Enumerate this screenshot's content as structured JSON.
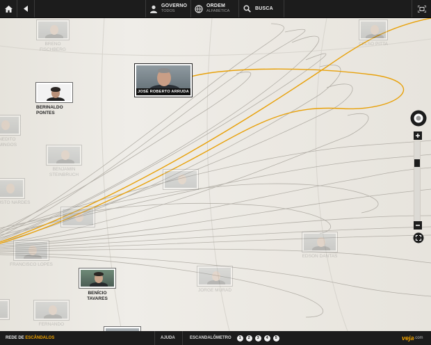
{
  "top_bar": {
    "governo": {
      "title": "GOVERNO",
      "sub": "TODOS"
    },
    "ordem": {
      "title": "ORDEM",
      "sub": "ALFABÉTICA"
    },
    "busca": {
      "title": "BUSCA"
    }
  },
  "nodes": {
    "focus": {
      "name": "JOSÉ ROBERTO ARRUDA"
    },
    "active": [
      {
        "name": "BERINALDO PONTES",
        "lines": [
          "BERINALDO",
          "PONTES"
        ]
      },
      {
        "name": "BENÍCIO TAVARES",
        "lines": [
          "BENÍCIO TAVARES"
        ]
      }
    ],
    "faded": [
      {
        "label": "BRENO FISCHBERG"
      },
      {
        "label": "CELSO PITTA"
      },
      {
        "label": "BENEDITO DOMINGOS"
      },
      {
        "label": "BENJAMIN STEINBRUCH"
      },
      {
        "label": "AUGUSTO NARDES"
      },
      {
        "label": "EDSON DANTAS"
      },
      {
        "label": "FRANCISCO LOPES"
      },
      {
        "label": "JORGE MURAD"
      },
      {
        "label": "FERNANDO"
      }
    ]
  },
  "bottom_bar": {
    "brand_prefix": "REDE DE ",
    "brand_highlight": "ESCÂNDALOS",
    "ajuda": "AJUDA",
    "escandalometro": "ESCANDALÔMETRO",
    "pages": [
      "1",
      "2",
      "3",
      "4",
      "5"
    ],
    "logo": "veja",
    "logo_suffix": ".com"
  },
  "colors": {
    "accent": "#f0a300",
    "bar": "#1c1c1c",
    "highlight_curve": "#e8a10a"
  },
  "icons": [
    "home-icon",
    "back-arrow-icon",
    "person-icon",
    "globe-icon",
    "search-icon",
    "fullscreen-icon",
    "pan-control-icon",
    "zoom-in-icon",
    "zoom-out-icon",
    "fit-view-icon"
  ]
}
